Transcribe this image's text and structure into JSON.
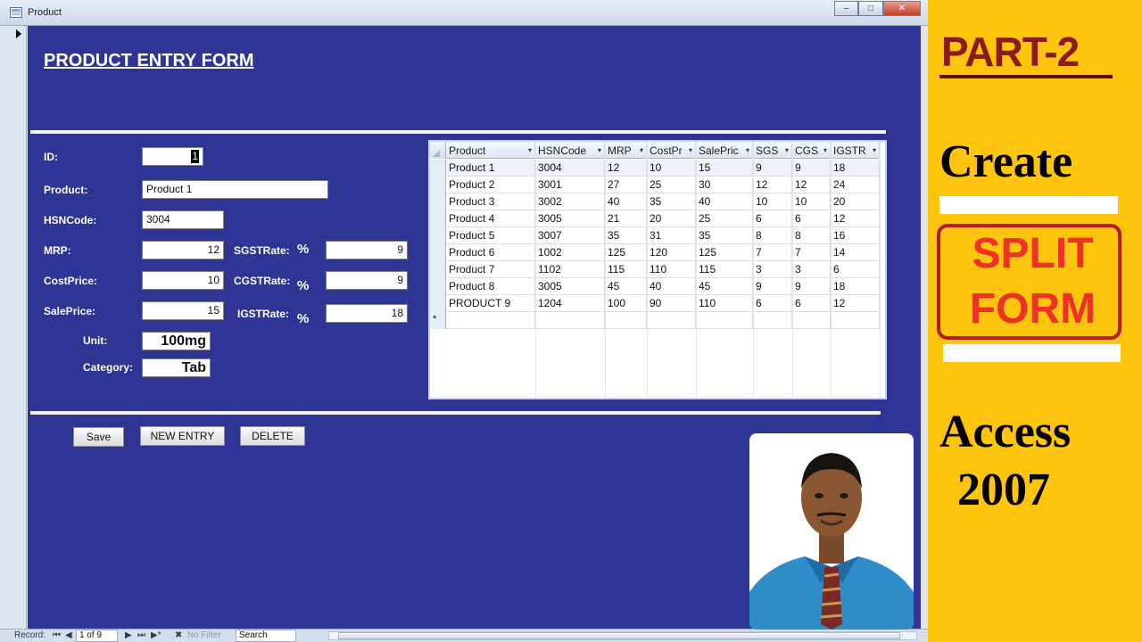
{
  "window": {
    "title": "Product"
  },
  "form": {
    "title": "PRODUCT ENTRY FORM",
    "labels": {
      "id": "ID:",
      "product": "Product:",
      "hsn": "HSNCode:",
      "mrp": "MRP:",
      "cost": "CostPrice:",
      "sale": "SalePrice:",
      "unit": "Unit:",
      "category": "Category:",
      "sgst": "SGSTRate:",
      "cgst": "CGSTRate:",
      "igst": "IGSTRate:",
      "percent": "%"
    },
    "values": {
      "id": "1",
      "product": "Product 1",
      "hsn": "3004",
      "mrp": "12",
      "cost": "10",
      "sale": "15",
      "unit": "100mg",
      "category": "Tab",
      "sgst": "9",
      "cgst": "9",
      "igst": "18"
    },
    "buttons": {
      "save": "Save",
      "new_entry": "NEW ENTRY",
      "delete": "DELETE"
    }
  },
  "datasheet": {
    "columns": [
      "Product",
      "HSNCode",
      "MRP",
      "CostPr",
      "SalePric",
      "SGS",
      "CGS",
      "IGSTR"
    ],
    "rows": [
      [
        "Product 1",
        "3004",
        "12",
        "10",
        "15",
        "9",
        "9",
        "18"
      ],
      [
        "Product 2",
        "3001",
        "27",
        "25",
        "30",
        "12",
        "12",
        "24"
      ],
      [
        "Product 3",
        "3002",
        "40",
        "35",
        "40",
        "10",
        "10",
        "20"
      ],
      [
        "Product 4",
        "3005",
        "21",
        "20",
        "25",
        "6",
        "6",
        "12"
      ],
      [
        "Product 5",
        "3007",
        "35",
        "31",
        "35",
        "8",
        "8",
        "16"
      ],
      [
        "Product 6",
        "1002",
        "125",
        "120",
        "125",
        "7",
        "7",
        "14"
      ],
      [
        "Product 7",
        "1102",
        "115",
        "110",
        "115",
        "3",
        "3",
        "6"
      ],
      [
        "Product 8",
        "3005",
        "45",
        "40",
        "45",
        "9",
        "9",
        "18"
      ],
      [
        "PRODUCT 9",
        "1204",
        "100",
        "90",
        "110",
        "6",
        "6",
        "12"
      ]
    ],
    "new_row_marker": "*"
  },
  "statusbar": {
    "record_label": "Record:",
    "record_position": "1 of 9",
    "filter": "No Filter",
    "search": "Search"
  },
  "banner": {
    "part": "PART-2",
    "create": "Create",
    "split": "SPLIT",
    "form": "FORM",
    "access": "Access",
    "year": "2007"
  },
  "colors": {
    "form_background": "#2e3594",
    "banner_background": "#fec40e",
    "part_text": "#8b1a1a",
    "split_text": "#ee3124"
  }
}
